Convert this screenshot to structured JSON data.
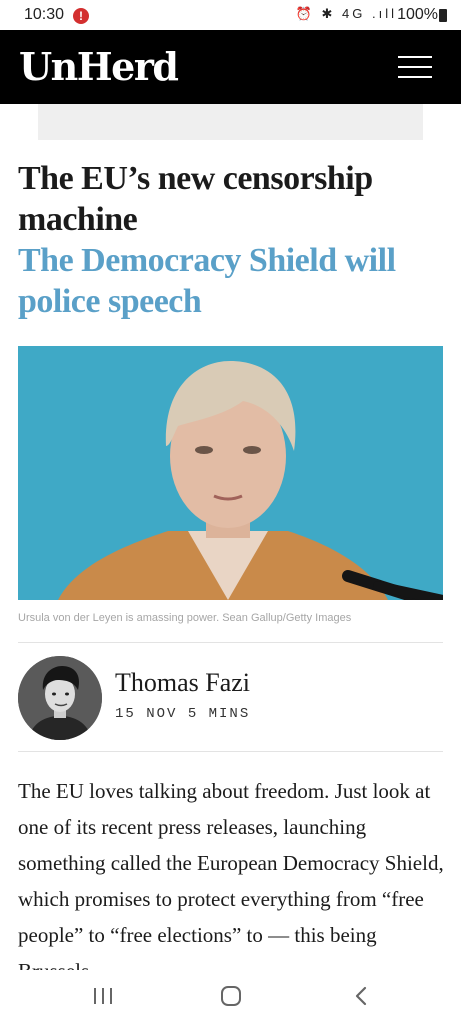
{
  "status_bar": {
    "time": "10:30",
    "alert_glyph": "!",
    "icons": "⏰ ✱ 4G .ıll",
    "battery": "100%"
  },
  "header": {
    "logo": "UnHerd",
    "menu_icon": "hamburger-menu-icon"
  },
  "article": {
    "title": "The EU’s new censorship machine",
    "subtitle": "The Democracy Shield will police speech",
    "image_caption": "Ursula von der Leyen is amassing power. Sean Gallup/Getty Images",
    "author": "Thomas Fazi",
    "date": "15 NOV",
    "read_time": "5 MINS",
    "body": "The EU loves talking about freedom. Just look at one of its recent press releases, launching something called the European Democracy Shield, which promises to protect everything from “free people” to “free elections” to — this being Brussels"
  },
  "nav_bar": {
    "recent_icon": "recent-apps-icon",
    "home_icon": "home-icon",
    "back_icon": "back-icon"
  },
  "colors": {
    "header_bg": "#000000",
    "subtitle": "#5aa0c8",
    "hero_bg": "#3fa9c6",
    "jacket": "#c98a4a"
  }
}
